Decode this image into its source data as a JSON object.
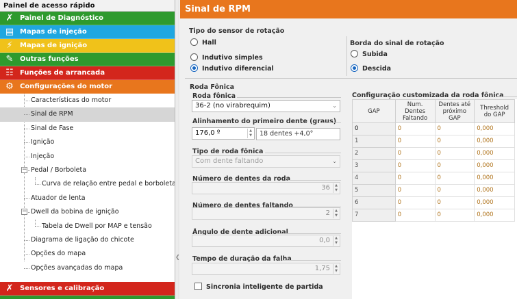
{
  "sidebar": {
    "title": "Painel de acesso rápido",
    "categories": [
      {
        "label": "Painel de Diagnóstico",
        "color": "#2e9a2e",
        "icon": "diagnostic-icon"
      },
      {
        "label": "Mapas de injeção",
        "color": "#1fa7e0",
        "icon": "injection-map-icon"
      },
      {
        "label": "Mapas de ignição",
        "color": "#f0c21a",
        "icon": "ignition-map-icon"
      },
      {
        "label": "Outras funções",
        "color": "#2e9a2e",
        "icon": "other-functions-icon"
      },
      {
        "label": "Funções de arrancada",
        "color": "#d3261c",
        "icon": "drag-functions-icon"
      },
      {
        "label": "Configurações do motor",
        "color": "#e8761d",
        "icon": "engine-config-icon"
      }
    ],
    "tree": [
      "Características do motor",
      "Sinal de RPM",
      "Sinal de Fase",
      "Ignição",
      "Injeção",
      "Pedal / Borboleta",
      "Curva de relação entre pedal e borboleta",
      "Atuador de lenta",
      "Dwell da bobina de ignição",
      "Tabela de Dwell por MAP e tensão",
      "Diagrama de ligação do chicote",
      "Opções do mapa",
      "Opções avançadas do mapa"
    ],
    "bottom_category": {
      "label": "Sensores e calibração",
      "color": "#d3261c"
    }
  },
  "main": {
    "title": "Sinal de RPM",
    "sensor_type": {
      "label": "Tipo do sensor de rotação",
      "options": [
        "Hall",
        "Indutivo simples",
        "Indutivo diferencial"
      ],
      "selected": "Indutivo diferencial"
    },
    "signal_edge": {
      "label": "Borda do sinal de rotação",
      "options": [
        "Subida",
        "Descida"
      ],
      "selected": "Descida"
    },
    "wheel": {
      "section_label": "Roda Fônica",
      "wheel_label": "Roda fônica",
      "wheel_value": "36-2 (no virabrequim)",
      "alignment_label": "Alinhamento do primeiro dente (graus)",
      "alignment_value": "176,0 º",
      "alignment_hint": "18 dentes +4,0°",
      "wheel_type_label": "Tipo de roda fônica",
      "wheel_type_value": "Com dente faltando",
      "teeth_label": "Número de dentes da roda",
      "teeth_value": "36",
      "missing_label": "Número de dentes faltando",
      "missing_value": "2",
      "extra_angle_label": "Ângulo de dente adicional",
      "extra_angle_value": "0,0",
      "failure_time_label": "Tempo de duração da falha",
      "failure_time_value": "1,75",
      "smart_sync_label": "Sincronia inteligente de partida"
    },
    "custom": {
      "label": "Configuração customizada da roda fônica",
      "headers": [
        "GAP",
        "Num. Dentes Faltando",
        "Dentes até próximo GAP",
        "Threshold do GAP"
      ],
      "rows": [
        [
          "0",
          "0",
          "0",
          "0,000"
        ],
        [
          "1",
          "0",
          "0",
          "0,000"
        ],
        [
          "2",
          "0",
          "0",
          "0,000"
        ],
        [
          "3",
          "0",
          "0",
          "0,000"
        ],
        [
          "4",
          "0",
          "0",
          "0,000"
        ],
        [
          "5",
          "0",
          "0",
          "0,000"
        ],
        [
          "6",
          "0",
          "0",
          "0,000"
        ],
        [
          "7",
          "0",
          "0",
          "0,000"
        ]
      ]
    }
  }
}
